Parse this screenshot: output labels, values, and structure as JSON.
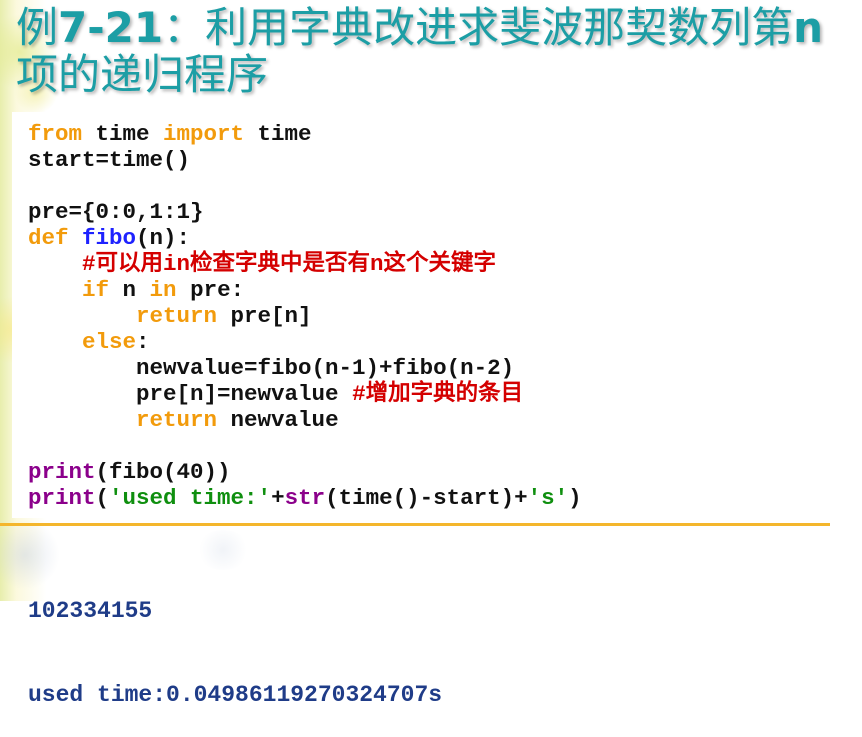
{
  "title": {
    "prefix": "例",
    "number": "7-21",
    "middle": "：利用字典改进求斐波那契数列第",
    "variable": "n",
    "line2": "项的递归程序"
  },
  "code": {
    "lines": [
      [
        {
          "keyword": "from"
        },
        {
          "plain": " time "
        },
        {
          "keyword": "import"
        },
        {
          "plain": " time"
        }
      ],
      [
        {
          "plain": "start=time()"
        }
      ],
      [],
      [
        {
          "plain": "pre={0:0,1:1}"
        }
      ],
      [
        {
          "keyword": "def"
        },
        {
          "plain": " "
        },
        {
          "function_name": "fibo"
        },
        {
          "plain": "(n):"
        }
      ],
      [
        {
          "plain": "    "
        },
        {
          "comment": "#可以用in检查字典中是否有n这个关键字"
        }
      ],
      [
        {
          "plain": "    "
        },
        {
          "keyword": "if"
        },
        {
          "plain": " n "
        },
        {
          "keyword": "in"
        },
        {
          "plain": " pre:"
        }
      ],
      [
        {
          "plain": "        "
        },
        {
          "keyword": "return"
        },
        {
          "plain": " pre[n]"
        }
      ],
      [
        {
          "plain": "    "
        },
        {
          "keyword": "else"
        },
        {
          "plain": ":"
        }
      ],
      [
        {
          "plain": "        newvalue=fibo(n-1)+fibo(n-2)"
        }
      ],
      [
        {
          "plain": "        pre[n]=newvalue "
        },
        {
          "comment": "#增加字典的条目"
        }
      ],
      [
        {
          "plain": "        "
        },
        {
          "keyword": "return"
        },
        {
          "plain": " newvalue"
        }
      ],
      [],
      [
        {
          "builtin": "print"
        },
        {
          "plain": "(fibo(40))"
        }
      ],
      [
        {
          "builtin": "print"
        },
        {
          "plain": "("
        },
        {
          "string": "'used time:'"
        },
        {
          "plain": "+"
        },
        {
          "builtin": "str"
        },
        {
          "plain": "(time()-start)+"
        },
        {
          "string": "'s'"
        },
        {
          "plain": ")"
        }
      ]
    ]
  },
  "output": {
    "lines": [
      "102334155",
      "used time:0.04986119270324707s"
    ]
  },
  "colors": {
    "title": "#1c9ea5",
    "keyword": "#f29b0c",
    "function_name": "#1e22ff",
    "builtin": "#8b008b",
    "string": "#0f8f0f",
    "comment": "#d40000",
    "plain": "#111111",
    "output": "#1f3c88",
    "divider": "#f4b62c"
  }
}
